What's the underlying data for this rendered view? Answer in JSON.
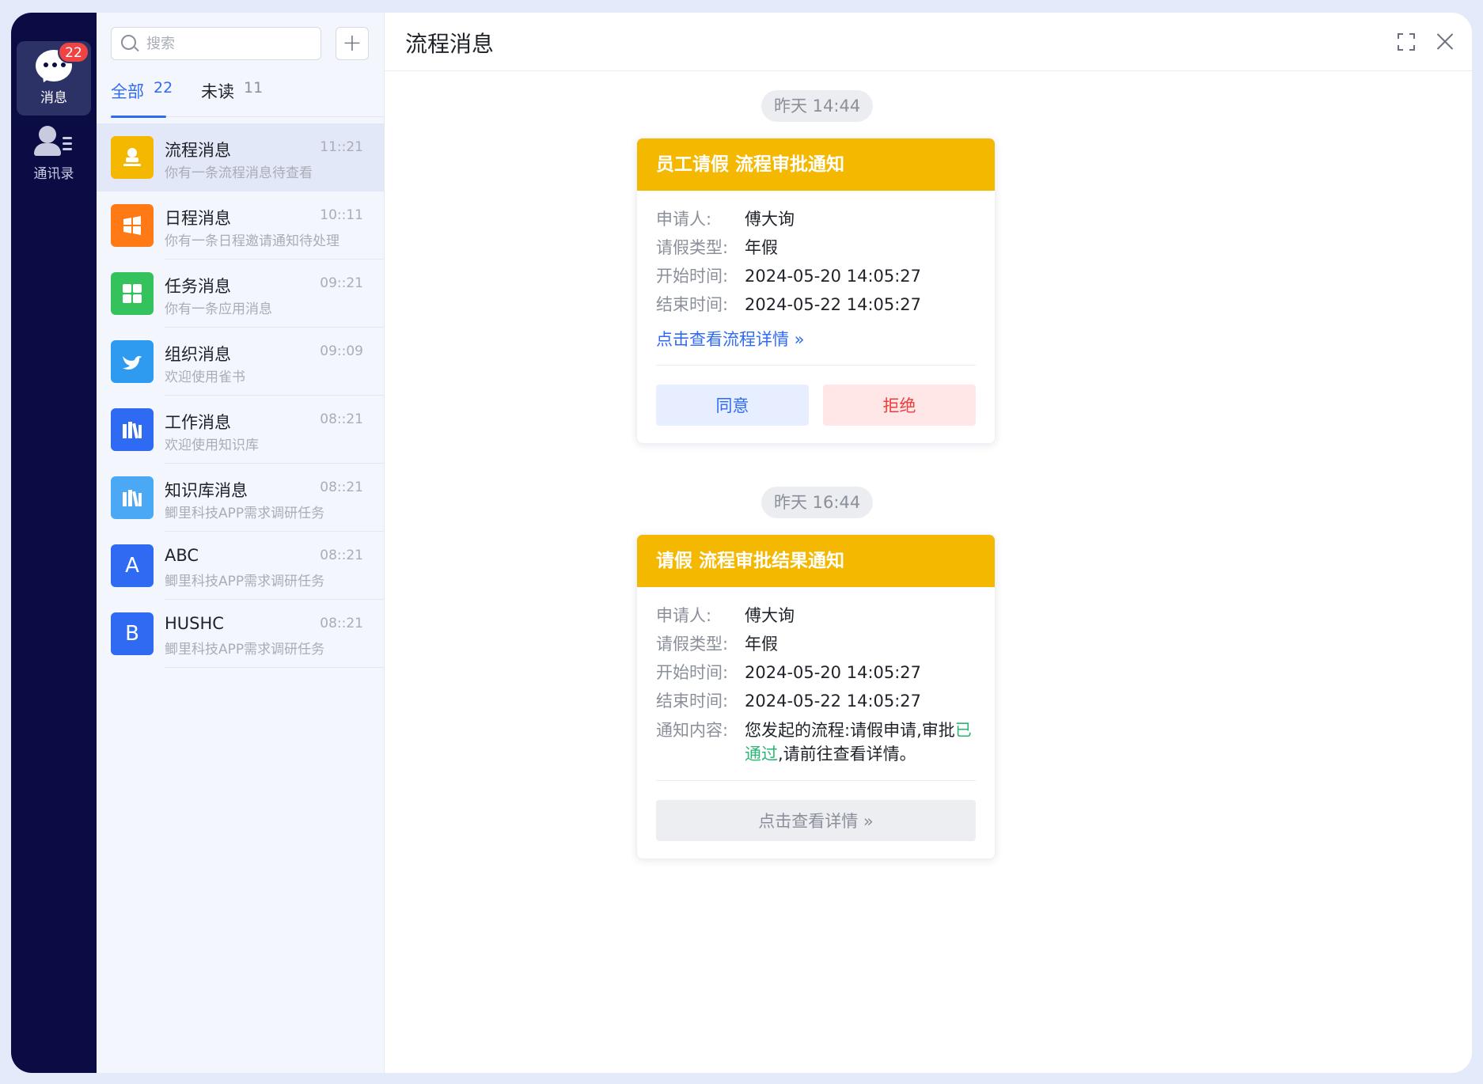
{
  "rail": {
    "messages": {
      "label": "消息",
      "badge": "22"
    },
    "contacts": {
      "label": "通讯录"
    }
  },
  "list": {
    "search_placeholder": "搜索",
    "add_symbol": "+",
    "tabs": [
      {
        "label": "全部",
        "count": "22"
      },
      {
        "label": "未读",
        "count": "11"
      }
    ],
    "items": [
      {
        "title": "流程消息",
        "time": "11::21",
        "sub": "你有一条流程消息待查看",
        "icon": "person-stamp-icon",
        "color": "#f5b800"
      },
      {
        "title": "日程消息",
        "time": "10::11",
        "sub": "你有一条日程邀请通知待处理",
        "icon": "calendar-icon",
        "color": "#ff7a14"
      },
      {
        "title": "任务消息",
        "time": "09::21",
        "sub": "你有一条应用消息",
        "icon": "grid-icon",
        "color": "#33c25b"
      },
      {
        "title": "组织消息",
        "time": "09::09",
        "sub": "欢迎使用雀书",
        "icon": "bird-icon",
        "color": "#2e9bf0"
      },
      {
        "title": "工作消息",
        "time": "08::21",
        "sub": "欢迎使用知识库",
        "icon": "books-icon",
        "color": "#2f6bf2"
      },
      {
        "title": "知识库消息",
        "time": "08::21",
        "sub": "鲫里科技APP需求调研任务",
        "icon": "books-icon",
        "color": "#4aa8f5"
      },
      {
        "title": "ABC",
        "time": "08::21",
        "sub": "鲫里科技APP需求调研任务",
        "icon": "letter-a-icon",
        "letter": "A",
        "color": "#2f6bf2"
      },
      {
        "title": "HUSHC",
        "time": "08::21",
        "sub": "鲫里科技APP需求调研任务",
        "icon": "letter-b-icon",
        "letter": "B",
        "color": "#2f6bf2"
      }
    ]
  },
  "main": {
    "title": "流程消息",
    "messages": [
      {
        "time": "昨天 14:44",
        "card_title": "员工请假  流程审批通知",
        "fields": [
          {
            "k": "申请人:",
            "v": "傅大询"
          },
          {
            "k": "请假类型:",
            "v": "年假"
          },
          {
            "k": "开始时间:",
            "v": "2024-05-20 14:05:27"
          },
          {
            "k": "结束时间:",
            "v": "2024-05-22 14:05:27"
          }
        ],
        "link": "点击查看流程详情 »",
        "agree": "同意",
        "reject": "拒绝"
      },
      {
        "time": "昨天 16:44",
        "card_title": "请假  流程审批结果通知",
        "fields": [
          {
            "k": "申请人:",
            "v": "傅大询"
          },
          {
            "k": "请假类型:",
            "v": "年假"
          },
          {
            "k": "开始时间:",
            "v": "2024-05-20 14:05:27"
          },
          {
            "k": "结束时间:",
            "v": "2024-05-22 14:05:27"
          }
        ],
        "content_label": "通知内容:",
        "content_pre": "您发起的流程:请假申请,审批",
        "content_status": "已通过",
        "content_post": ",请前往查看详情。",
        "detail_button": "点击查看详情 »"
      }
    ]
  },
  "colors": {
    "accent": "#2f6bf2",
    "card_header": "#f4b800",
    "rail": "#0c0c44",
    "success": "#2bb673",
    "danger": "#f03c3c"
  }
}
